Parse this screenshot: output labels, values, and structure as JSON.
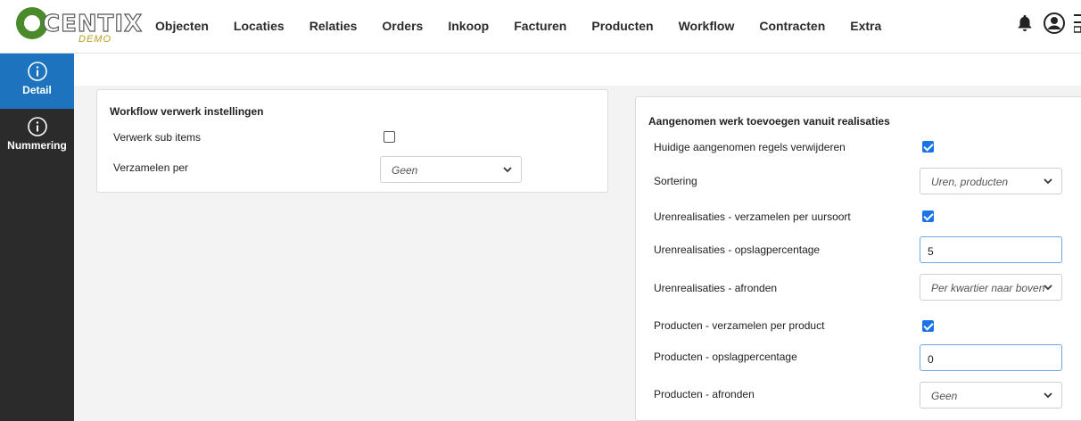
{
  "nav": {
    "logo_text": "CENTIX",
    "logo_sub": "DEMO",
    "items": [
      "Objecten",
      "Locaties",
      "Relaties",
      "Orders",
      "Inkoop",
      "Facturen",
      "Producten",
      "Workflow",
      "Contracten",
      "Extra"
    ]
  },
  "sidebar": {
    "items": [
      {
        "label": "Detail",
        "icon": "info-icon",
        "active": true
      },
      {
        "label": "Nummering",
        "icon": "info-icon",
        "active": false
      }
    ]
  },
  "left_panel": {
    "title": "Workflow verwerk instellingen",
    "rows": [
      {
        "label": "Verwerk sub items",
        "type": "checkbox",
        "checked": false
      },
      {
        "label": "Verzamelen per",
        "type": "select",
        "value": "Geen"
      }
    ]
  },
  "right_panel": {
    "title": "Aangenomen werk toevoegen vanuit realisaties",
    "rows": [
      {
        "label": "Huidige aangenomen regels verwijderen",
        "type": "checkbox",
        "checked": true
      },
      {
        "label": "Sortering",
        "type": "select",
        "value": "Uren, producten"
      },
      {
        "label": "Urenrealisaties - verzamelen per uursoort",
        "type": "checkbox",
        "checked": true
      },
      {
        "label": "Urenrealisaties - opslagpercentage",
        "type": "input",
        "value": "5"
      },
      {
        "label": "Urenrealisaties - afronden",
        "type": "select",
        "value": "Per kwartier naar boven"
      },
      {
        "label": "Producten - verzamelen per product",
        "type": "checkbox",
        "checked": true
      },
      {
        "label": "Producten - opslagpercentage",
        "type": "input",
        "value": "0"
      },
      {
        "label": "Producten - afronden",
        "type": "select",
        "value": "Geen"
      }
    ]
  },
  "colors": {
    "sidebar_bg": "#2b2b2b",
    "sidebar_active": "#1e73be",
    "checkbox_checked": "#1a73e8",
    "logo_green": "#4a8a2a"
  }
}
